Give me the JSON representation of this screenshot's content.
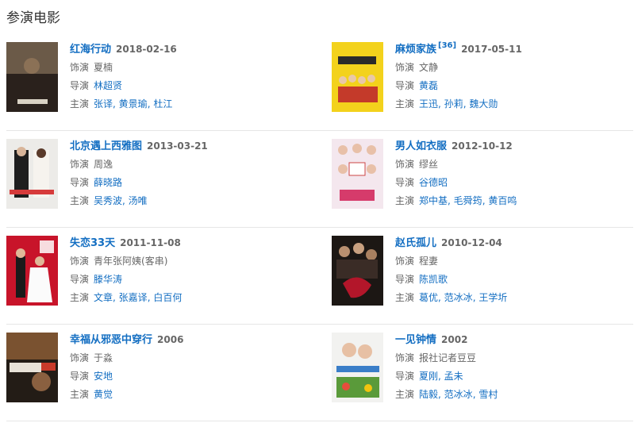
{
  "section_title": "参演电影",
  "labels": {
    "role": "饰演",
    "director": "导演",
    "stars": "主演"
  },
  "movies": [
    {
      "name": "红海行动",
      "ref": "",
      "date": "2018-02-16",
      "role": "夏楠",
      "director": [
        "林超贤"
      ],
      "stars": [
        "张译",
        "黄景瑜",
        "杜江"
      ]
    },
    {
      "name": "麻烦家族",
      "ref": "[36]",
      "date": "2017-05-11",
      "role": "文静",
      "director": [
        "黄磊"
      ],
      "stars": [
        "王迅",
        "孙莉",
        "魏大勋"
      ]
    },
    {
      "name": "北京遇上西雅图",
      "ref": "",
      "date": "2013-03-21",
      "role": "周逸",
      "director": [
        "薛晓路"
      ],
      "stars": [
        "吴秀波",
        "汤唯"
      ]
    },
    {
      "name": "男人如衣服",
      "ref": "",
      "date": "2012-10-12",
      "role": "缪丝",
      "director": [
        "谷德昭"
      ],
      "stars": [
        "郑中基",
        "毛舜筠",
        "黄百鸣"
      ]
    },
    {
      "name": "失恋33天",
      "ref": "",
      "date": "2011-11-08",
      "role": "青年张阿姨(客串)",
      "director": [
        "滕华涛"
      ],
      "stars": [
        "文章",
        "张嘉译",
        "白百何"
      ]
    },
    {
      "name": "赵氏孤儿",
      "ref": "",
      "date": "2010-12-04",
      "role": "程妻",
      "director": [
        "陈凯歌"
      ],
      "stars": [
        "葛优",
        "范冰冰",
        "王学圻"
      ]
    },
    {
      "name": "幸福从邪恶中穿行",
      "ref": "",
      "date": "2006",
      "role": "于淼",
      "director": [
        "安地"
      ],
      "stars": [
        "黄觉"
      ]
    },
    {
      "name": "一见钟情",
      "ref": "",
      "date": "2002",
      "role": "报社记者豆豆",
      "director": [
        "夏刚",
        "孟未"
      ],
      "stars": [
        "陆毅",
        "范冰冰",
        "雪村"
      ]
    }
  ],
  "colors": {
    "link": "#136ec2",
    "muted": "#666666",
    "divider": "#e6e6e6"
  }
}
